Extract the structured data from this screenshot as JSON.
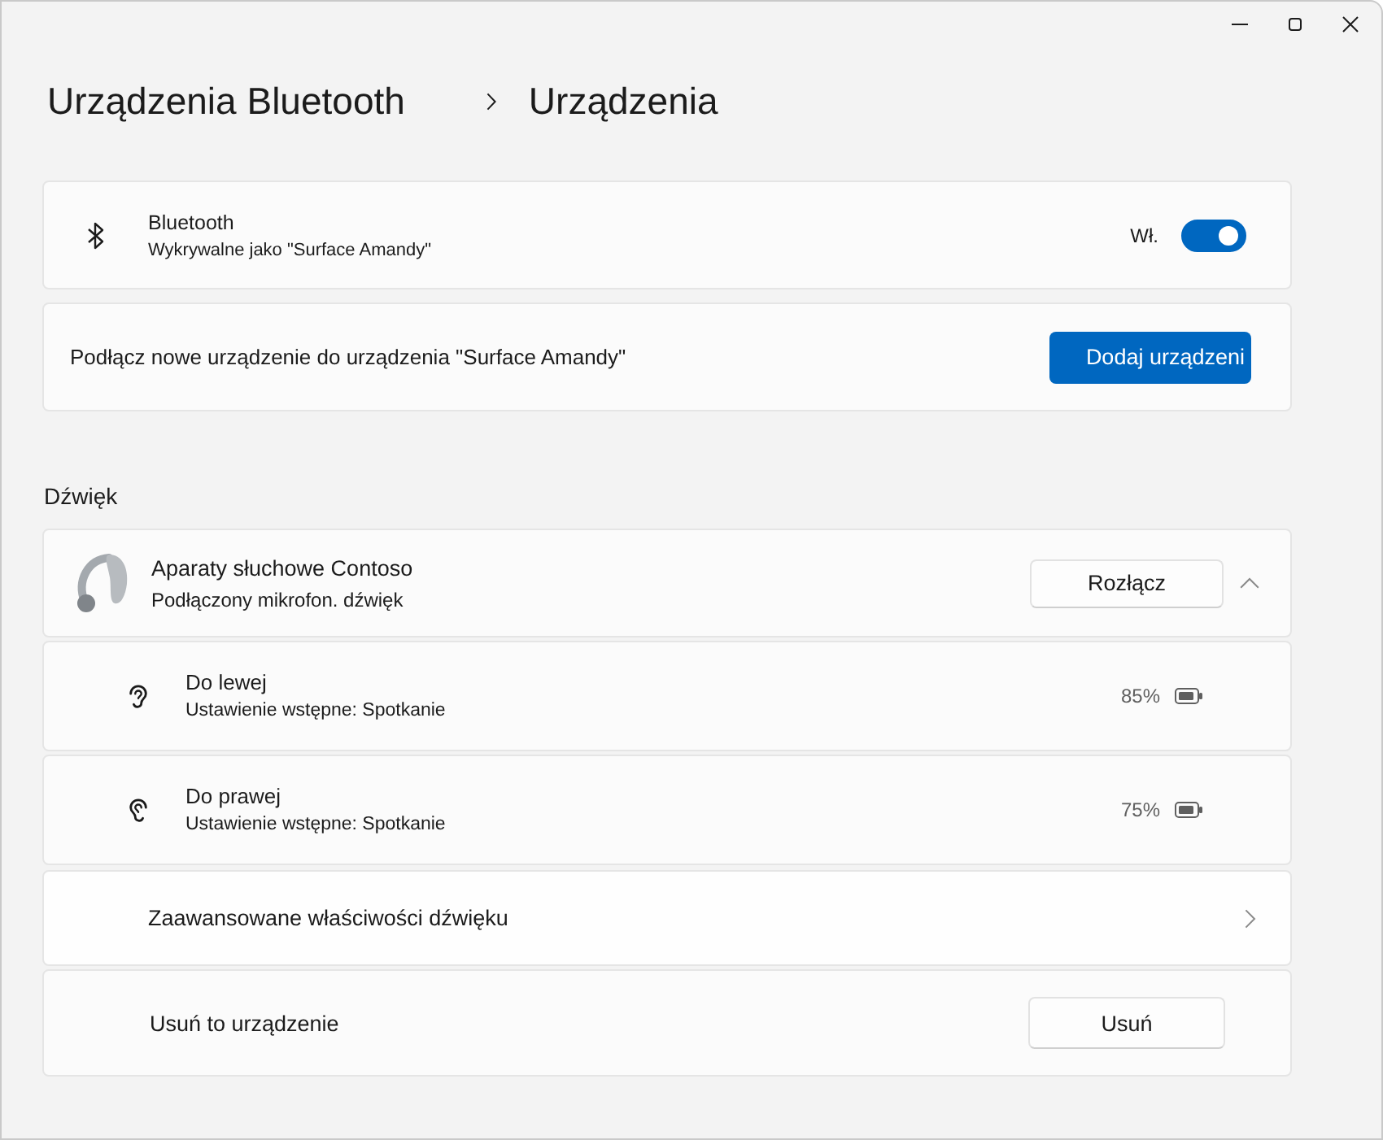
{
  "breadcrumb": [
    "Urządzenia Bluetooth",
    "Urządzenia"
  ],
  "bluetooth": {
    "title": "Bluetooth",
    "subtitle": "Wykrywalne jako \"Surface Amandy\"",
    "state_label": "Wł.",
    "on": true
  },
  "add_device": {
    "text": "Podłącz nowe urządzenie do urządzenia \"Surface Amandy\"",
    "button": "Dodaj urządzeni"
  },
  "sound": {
    "heading": "Dźwięk",
    "device": {
      "name": "Aparaty słuchowe Contoso",
      "status": "Podłączony mikrofon. dźwięk",
      "button": "Rozłącz",
      "expanded": true,
      "earpieces": [
        {
          "kind": "left",
          "name": "Do lewej",
          "preset": "Ustawienie wstępne: Spotkanie",
          "battery": "85%"
        },
        {
          "kind": "right",
          "name": "Do prawej",
          "preset": "Ustawienie wstępne: Spotkanie",
          "battery": "75%"
        }
      ],
      "advanced_link": "Zaawansowane właściwości dźwięku",
      "remove": {
        "label": "Usuń to urządzenie",
        "button": "Usuń"
      }
    }
  }
}
